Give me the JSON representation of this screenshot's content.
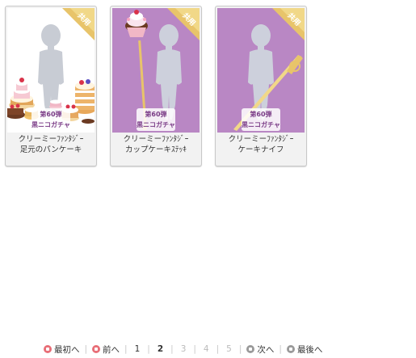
{
  "items": [
    {
      "line1": "クリーミーﾌｧﾝﾀｼﾞｰ",
      "line2": "足元のパンケーキ",
      "tag": "共用",
      "badge_top": "第60弾",
      "badge_bottom": "黒ニコガチャ",
      "theme": "white"
    },
    {
      "line1": "クリーミーﾌｧﾝﾀｼﾞｰ",
      "line2": "カップケーキｽﾃｯｷ",
      "tag": "共用",
      "badge_top": "第60弾",
      "badge_bottom": "黒ニコガチャ",
      "theme": "purple"
    },
    {
      "line1": "クリーミーﾌｧﾝﾀｼﾞｰ",
      "line2": "ケーキナイフ",
      "tag": "共用",
      "badge_top": "第60弾",
      "badge_bottom": "黒ニコガチャ",
      "theme": "purple"
    }
  ],
  "pager": {
    "first_label": "最初へ",
    "prev_label": "前へ",
    "pages": [
      "1",
      "2",
      "3",
      "4",
      "5"
    ],
    "current_page": "2",
    "next_label": "次へ",
    "last_label": "最後へ"
  },
  "colors": {
    "purple_bg": "#b987c4",
    "gold": "#e8c46a",
    "pager_red": "#e86e77",
    "pager_gray": "#9a9a9a"
  }
}
